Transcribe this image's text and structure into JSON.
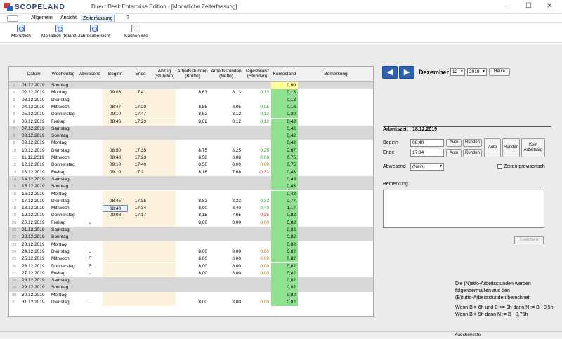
{
  "window": {
    "app": "SCOPELAND",
    "title": "Direct Desk Enterprise Edition - [Monatliche Zeiterfassung]",
    "min": "—",
    "max": "☐",
    "close": "✕"
  },
  "menu": {
    "m1": "Allgemein",
    "m2": "Ansicht",
    "m3": "Zeiterfassung",
    "help": "?"
  },
  "ribbon": {
    "b1": "Monatlich",
    "b2": "Monatlich (Bilanz)",
    "b3": "Jahresübersicht",
    "b4": "Küchenliste"
  },
  "table": {
    "headers": [
      "Datum",
      "Wochentag",
      "Abwesend",
      "Beginn",
      "Ende",
      "Abzug (Stunden)",
      "Arbeitsstunden (Brutto)",
      "Arbeitsstunden (Netto)",
      "Tagesbilanz (Stunden)",
      "Kontostand",
      "Bemerkung"
    ],
    "rows": [
      [
        "1",
        "01.12.2019",
        "Sonntag",
        "",
        "",
        "",
        "",
        "",
        "",
        "",
        "0,00"
      ],
      [
        "2",
        "02.12.2019",
        "Montag",
        "",
        "09:03",
        "17:41",
        "",
        "8,63",
        "8,13",
        "0,13",
        "0,13"
      ],
      [
        "3",
        "03.12.2019",
        "Dienstag",
        "",
        "",
        "",
        "",
        "",
        "",
        "",
        "0,13"
      ],
      [
        "4",
        "04.12.2019",
        "Mittwoch",
        "",
        "08:47",
        "17:20",
        "",
        "8,55",
        "8,05",
        "0,05",
        "0,18"
      ],
      [
        "5",
        "05.12.2019",
        "Donnerstag",
        "",
        "09:10",
        "17:47",
        "",
        "8,62",
        "8,12",
        "0,12",
        "0,30"
      ],
      [
        "6",
        "06.12.2019",
        "Freitag",
        "",
        "08:46",
        "17:23",
        "",
        "8,62",
        "8,12",
        "0,12",
        "0,42"
      ],
      [
        "7",
        "07.12.2019",
        "Samstag",
        "",
        "",
        "",
        "",
        "",
        "",
        "",
        "0,42"
      ],
      [
        "8",
        "08.12.2019",
        "Sonntag",
        "",
        "",
        "",
        "",
        "",
        "",
        "",
        "0,42"
      ],
      [
        "9",
        "09.12.2019",
        "Montag",
        "",
        "",
        "",
        "",
        "",
        "",
        "",
        "0,42"
      ],
      [
        "10",
        "10.12.2019",
        "Dienstag",
        "",
        "08:50",
        "17:35",
        "",
        "8,75",
        "8,25",
        "0,25",
        "0,67"
      ],
      [
        "11",
        "11.12.2019",
        "Mittwoch",
        "",
        "08:48",
        "17:23",
        "",
        "8,58",
        "8,08",
        "0,08",
        "0,75"
      ],
      [
        "12",
        "12.12.2019",
        "Donnerstag",
        "",
        "09:10",
        "17:40",
        "",
        "8,50",
        "8,00",
        "0,00",
        "0,75"
      ],
      [
        "13",
        "13.12.2019",
        "Freitag",
        "",
        "09:10",
        "17:21",
        "",
        "8,18",
        "7,68",
        "-0,32",
        "0,43"
      ],
      [
        "14",
        "14.12.2019",
        "Samstag",
        "",
        "",
        "",
        "",
        "",
        "",
        "",
        "0,43"
      ],
      [
        "15",
        "15.12.2019",
        "Sonntag",
        "",
        "",
        "",
        "",
        "",
        "",
        "",
        "0,43"
      ],
      [
        "16",
        "16.12.2019",
        "Montag",
        "",
        "",
        "",
        "",
        "",
        "",
        "",
        "0,43"
      ],
      [
        "17",
        "17.12.2019",
        "Dienstag",
        "",
        "08:45",
        "17:35",
        "",
        "8,83",
        "8,33",
        "0,33",
        "0,77"
      ],
      [
        "18",
        "18.12.2019",
        "Mittwoch",
        "",
        "08:40",
        "17:34",
        "",
        "8,90",
        "8,40",
        "0,40",
        "1,17"
      ],
      [
        "19",
        "19.12.2019",
        "Donnerstag",
        "",
        "09:08",
        "17:17",
        "",
        "8,15",
        "7,65",
        "-0,35",
        "0,82"
      ],
      [
        "20",
        "20.12.2019",
        "Freitag",
        "U",
        "",
        "",
        "",
        "8,00",
        "8,00",
        "0,00",
        "0,82"
      ],
      [
        "21",
        "21.12.2019",
        "Samstag",
        "",
        "",
        "",
        "",
        "",
        "",
        "",
        "0,82"
      ],
      [
        "22",
        "22.12.2019",
        "Sonntag",
        "",
        "",
        "",
        "",
        "",
        "",
        "",
        "0,82"
      ],
      [
        "23",
        "23.12.2019",
        "Montag",
        "",
        "",
        "",
        "",
        "",
        "",
        "",
        "0,82"
      ],
      [
        "24",
        "24.12.2019",
        "Dienstag",
        "U",
        "",
        "",
        "",
        "8,00",
        "8,00",
        "0,00",
        "0,82"
      ],
      [
        "25",
        "25.12.2019",
        "Mittwoch",
        "F",
        "",
        "",
        "",
        "8,00",
        "8,00",
        "0,00",
        "0,82"
      ],
      [
        "26",
        "26.12.2019",
        "Donnerstag",
        "F",
        "",
        "",
        "",
        "8,00",
        "8,00",
        "0,00",
        "0,82"
      ],
      [
        "27",
        "27.12.2019",
        "Freitag",
        "U",
        "",
        "",
        "",
        "8,00",
        "8,00",
        "0,00",
        "0,82"
      ],
      [
        "28",
        "28.12.2019",
        "Samstag",
        "",
        "",
        "",
        "",
        "",
        "",
        "",
        "0,82"
      ],
      [
        "29",
        "29.12.2019",
        "Sonntag",
        "",
        "",
        "",
        "",
        "",
        "",
        "",
        "0,82"
      ],
      [
        "30",
        "30.12.2019",
        "Montag",
        "",
        "",
        "",
        "",
        "",
        "",
        "",
        "0,82"
      ],
      [
        "31",
        "31.12.2019",
        "Dienstag",
        "U",
        "",
        "",
        "",
        "8,00",
        "8,00",
        "0,00",
        "0,82"
      ]
    ]
  },
  "nav": {
    "prev": "◀",
    "next": "▶",
    "month": "Dezember",
    "month_num": "12",
    "year": "2019",
    "today": "Heute"
  },
  "detail": {
    "heading": "Arbeitszeit",
    "date": "18.12.2019",
    "beginn_label": "Beginn",
    "beginn": "08:40",
    "ende_label": "Ende",
    "ende": "17:34",
    "auto": "Auto",
    "runden": "Runden",
    "auto_big": "Auto",
    "runden_big": "Runden",
    "kein": "Kein Arbeitstag",
    "abwesend_label": "Abwesend",
    "abwesend": "(Nein)",
    "provisorisch": "Zeiten provisorisch",
    "bemerkung_label": "Bemerkung",
    "save": "Speichern"
  },
  "note": {
    "l1": "Die (N)etto-Arbeitsstunden werden",
    "l2": "folgendermaßen aus den",
    "l3": "(B)rutto-Arbeitsstunden berechnet:",
    "l4": "Wenn B > 6h und B <= 9h dann N := B - 0,5h",
    "l5": "Wenn B > 9h dann N := B - 0,75h"
  },
  "status": {
    "text": "Kuechenliste"
  }
}
